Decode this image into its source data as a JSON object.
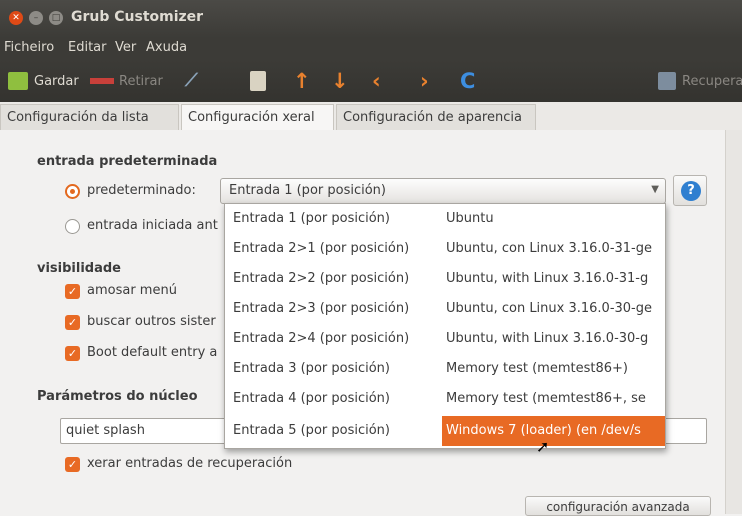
{
  "window": {
    "title": "Grub Customizer"
  },
  "menu": [
    "Ficheiro",
    "Editar",
    "Ver",
    "Axuda"
  ],
  "toolbar": {
    "save_label": "Gardar",
    "remove_label": "Retirar",
    "restore_label": "Recuperar"
  },
  "tabs": [
    "Configuración da lista",
    "Configuración xeral",
    "Configuración de aparencia"
  ],
  "default_entry": {
    "heading": "entrada predeterminada",
    "predefined_label": "predeterminado:",
    "started_label": "entrada iniciada ant",
    "combo_value": "Entrada 1 (por posición)"
  },
  "visibility": {
    "heading": "visibilidade",
    "show_menu": "amosar menú",
    "search_other": "buscar outros sister",
    "boot_default": "Boot default entry a"
  },
  "kernel": {
    "heading": "Parámetros do núcleo",
    "value": "quiet splash",
    "recovery": "xerar entradas de recuperación"
  },
  "advanced_button": "configuración avanzada",
  "dropdown": [
    {
      "entry": "Entrada 1 (por posición)",
      "name": "Ubuntu"
    },
    {
      "entry": "Entrada 2>1 (por posición)",
      "name": "Ubuntu, con Linux 3.16.0-31-ge"
    },
    {
      "entry": "Entrada 2>2 (por posición)",
      "name": "Ubuntu, with Linux 3.16.0-31-g"
    },
    {
      "entry": "Entrada 2>3 (por posición)",
      "name": "Ubuntu, con Linux 3.16.0-30-ge"
    },
    {
      "entry": "Entrada 2>4 (por posición)",
      "name": "Ubuntu, with Linux 3.16.0-30-g"
    },
    {
      "entry": "Entrada 3 (por posición)",
      "name": "Memory test (memtest86+)"
    },
    {
      "entry": "Entrada 4 (por posición)",
      "name": "Memory test (memtest86+, se"
    },
    {
      "entry": "Entrada 5 (por posición)",
      "name": "Windows 7 (loader) (en /dev/s"
    }
  ],
  "colors": {
    "accent": "#e86a24",
    "titlebar": "#3c3b37",
    "help": "#2f7fd0"
  }
}
